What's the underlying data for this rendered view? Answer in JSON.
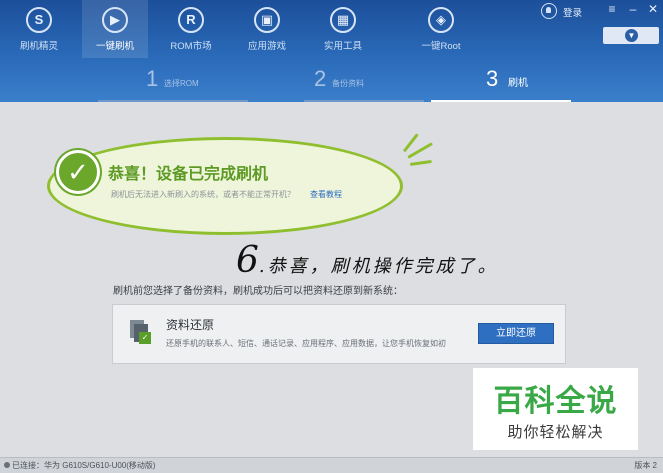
{
  "nav": {
    "items": [
      {
        "label": "刷机精灵",
        "icon": "shield-s-icon"
      },
      {
        "label": "一键刷机",
        "icon": "play-arrow-icon"
      },
      {
        "label": "ROM市场",
        "icon": "rom-r-icon"
      },
      {
        "label": "应用游戏",
        "icon": "bag-icon"
      },
      {
        "label": "实用工具",
        "icon": "grid-icon"
      },
      {
        "label": "一键Root",
        "icon": "car-icon"
      }
    ],
    "active_index": 1
  },
  "topbar": {
    "login_label": "登录"
  },
  "steps": [
    {
      "number": "1",
      "label": "选择ROM"
    },
    {
      "number": "2",
      "label": "备份资料"
    },
    {
      "number": "3",
      "label": "刷机"
    }
  ],
  "result": {
    "title": "恭喜！设备已完成刷机",
    "subtitle": "刷机后无法进入新刷入的系统，或者不能正常开机？",
    "tutorial_link": "查看教程"
  },
  "annotation": {
    "number": "6",
    "text": ".恭喜，刷机操作完成了。"
  },
  "prompt": "刷机前您选择了备份资料，刷机成功后可以把资料还原到新系统：",
  "restore": {
    "title": "资料还原",
    "description": "还原手机的联系人、短信、通话记录、应用程序、应用数据，让您手机恢复如初",
    "button_label": "立即还原"
  },
  "status": {
    "left": "已连接：华为 G610S/G610-U00(移动版)",
    "right": "版本 2"
  },
  "watermark": {
    "title": "百科全说",
    "subtitle": "助你轻松解决"
  },
  "colors": {
    "header": "#2a6ab8",
    "success_green": "#6aa72a",
    "link_blue": "#2c6cc4",
    "button_blue": "#2f6fc1"
  }
}
